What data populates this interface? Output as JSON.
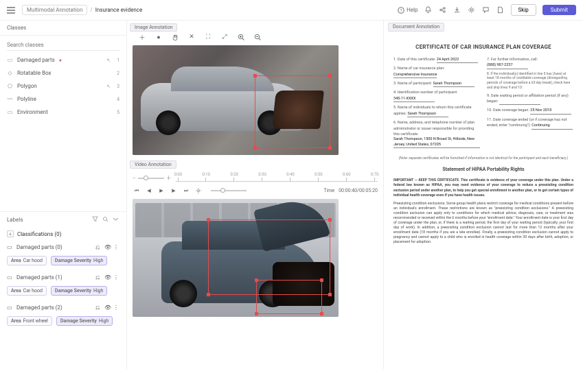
{
  "breadcrumb": {
    "parent": "Multimodal Annotation",
    "current": "Insurance evidence"
  },
  "topbar": {
    "help": "Help",
    "skip": "Skip",
    "submit": "Submit"
  },
  "classes": {
    "title": "Classes",
    "search_placeholder": "Search classes",
    "items": [
      {
        "label": "Damaged parts",
        "hotkey": "1"
      },
      {
        "label": "Rotatable Box",
        "hotkey": "2"
      },
      {
        "label": "Polygon",
        "hotkey": "3"
      },
      {
        "label": "Polyline",
        "hotkey": "4"
      },
      {
        "label": "Environment",
        "hotkey": "5"
      }
    ]
  },
  "labels": {
    "title": "Labels",
    "classifications": "Classifications (0)",
    "groups": [
      {
        "name": "Damaged parts (0)",
        "chips": [
          {
            "k": "Area",
            "v": "Car hood"
          },
          {
            "k": "Damage Severity",
            "v": "High",
            "hl": true
          }
        ]
      },
      {
        "name": "Damaged parts (1)",
        "chips": [
          {
            "k": "Area",
            "v": "Car hood"
          },
          {
            "k": "Damage Severity",
            "v": "High",
            "hl": true
          }
        ]
      },
      {
        "name": "Damaged parts (2)",
        "chips": [
          {
            "k": "Area",
            "v": "Front wheel"
          },
          {
            "k": "Damage Severity",
            "v": "High",
            "hl": true
          }
        ]
      }
    ]
  },
  "panels": {
    "image": "Image Annotation",
    "video": "Video Annotation",
    "doc": "Document Annotation"
  },
  "timeline": {
    "ticks": [
      "0:00",
      "0:10",
      "0:20",
      "0:30",
      "0:40",
      "0:50",
      "0:60",
      "0:70"
    ]
  },
  "player": {
    "time_label": "Time",
    "time_value": "00:00:40/00:05:20"
  },
  "doc": {
    "title": "CERTIFICATE OF CAR INSURANCE PLAN COVERAGE",
    "left": {
      "f1_lbl": "1.  Date of this certificate:",
      "f1_val": "24 April 2022",
      "f2_lbl": "2.  Name of car insurance plan:",
      "f2_val": "Comprehensive Insurance",
      "f3_lbl": "3.  Name of participant:",
      "f3_val": "Sarah Thompson",
      "f4_lbl": "4.  Identification number of participant:",
      "f4_val": "345-11-XXXX",
      "f5_lbl": "5.  Name of individuals to whom this certificate applies:",
      "f5_val": "Sarah Thompson",
      "f6_lbl": "6.  Name, address, and telephone number of plan administrator or issuer responsible for providing this certificate:",
      "f6_val": "Sarah Thompson, 1500 N Broad St, Hillside, New Jersey, United States, 07205"
    },
    "right": {
      "f7_lbl": "7.  For further information, call:",
      "f7_val": "(888) 987-2237",
      "f8_lbl": "8.  If the individual(s) identified in line 5 has (have) at least 18 months of creditable coverage (disregarding periods of coverage before a 63-day break), check here and skip lines 9 and 10:",
      "f9_lbl": "9.  Date waiting period or affiliation period (if any) began:",
      "f10_lbl": "10. Date coverage began:",
      "f10_val": "25 Nov 2018",
      "f11_lbl": "11. Date coverage ended (or if coverage has not ended, enter \"continuing\"):",
      "f11_val": "Continuing"
    },
    "note": "(Note: separate certificates will be furnished if information is not identical for the participant and each beneficiary.)",
    "sub": "Statement of HIPAA Portability Rights",
    "p1": "IMPORTANT — KEEP THIS CERTIFICATE. This certificate is evidence of your coverage under this plan. Under a federal law known as HIPAA, you may need evidence of your coverage to reduce a preexisting condition exclusion period under another plan, to help you get special enrollment in another plan, or to get certain types of individual health coverage even if you have health issues.",
    "p2": "Preexisting condition exclusions. Some group health plans restrict coverage for medical conditions present before an individual's enrollment. These restrictions are known as \"preexisting condition exclusions.\" A preexisting condition exclusion can apply only to conditions for which medical advice, diagnosis, care, or treatment was recommended or received within the 6 months before your \"enrollment date.\" Your enrollment date is your first day of coverage under the plan, or, if there is a waiting period, the first day of your waiting period (typically, your first day of work). In addition, a preexisting condition exclusion cannot last for more than 12 months after your enrollment date (18 months if you are a late enrollee). Finally, a preexisting condition exclusion cannot apply to pregnancy and cannot apply to a child who is enrolled in health coverage within 30 days after birth, adoption, or placement for adoption."
  }
}
